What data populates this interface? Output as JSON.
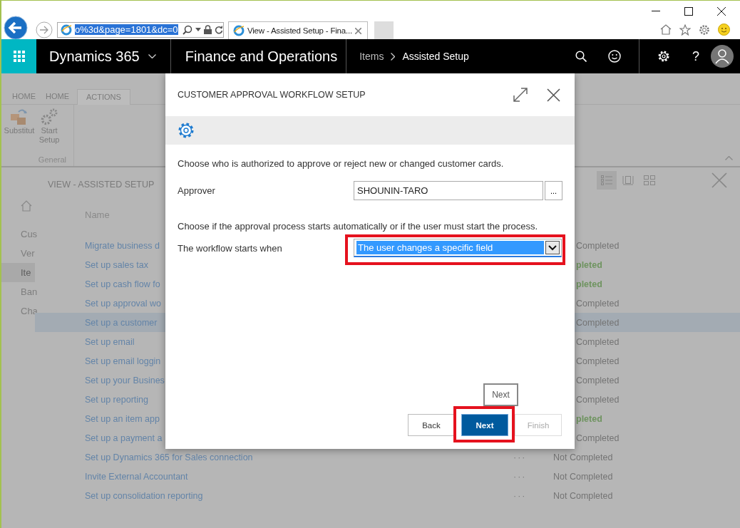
{
  "browser": {
    "address": "o%3d&page=1801&dc=0",
    "tab_title": "View - Assisted Setup - Fina..."
  },
  "app_bar": {
    "product": "Dynamics 365",
    "app": "Finance and Operations",
    "breadcrumb": [
      "Items",
      "Assisted Setup"
    ],
    "help": "?"
  },
  "ribbon": {
    "tabs": [
      {
        "label": "HOME",
        "selected": false
      },
      {
        "label": "HOME",
        "selected": false
      },
      {
        "label": "ACTIONS",
        "selected": true
      }
    ],
    "buttons": [
      {
        "label": "Substitut",
        "kind": "boxes"
      },
      {
        "label": "Start Setup",
        "kind": "gears"
      }
    ],
    "group": "General"
  },
  "page": {
    "title": "VIEW - ASSISTED SETUP",
    "views": [
      {
        "kind": "list",
        "selected": true
      },
      {
        "kind": "card",
        "selected": false
      },
      {
        "kind": "tiles",
        "selected": false
      }
    ],
    "nav": [
      {
        "label": "Cus",
        "selected": false
      },
      {
        "label": "Ver",
        "selected": false
      },
      {
        "label": "Ite",
        "selected": true
      },
      {
        "label": "Ban",
        "selected": false
      },
      {
        "label": "Cha",
        "selected": false
      }
    ],
    "column": "Name",
    "rows": [
      {
        "name": "Migrate business d",
        "status": "Completed",
        "completed": false,
        "selected": false
      },
      {
        "name": "Set up sales tax",
        "status": "pleted",
        "completed": true,
        "selected": false
      },
      {
        "name": "Set up cash flow fo",
        "status": "pleted",
        "completed": true,
        "selected": false
      },
      {
        "name": "Set up approval wo",
        "status": "Completed",
        "completed": false,
        "selected": false
      },
      {
        "name": "Set up a customer",
        "status": "Completed",
        "completed": false,
        "selected": true
      },
      {
        "name": "Set up email",
        "status": "Completed",
        "completed": false,
        "selected": false
      },
      {
        "name": "Set up email loggin",
        "status": "Completed",
        "completed": false,
        "selected": false
      },
      {
        "name": "Set up your Busines",
        "status": "Completed",
        "completed": false,
        "selected": false
      },
      {
        "name": "Set up reporting",
        "status": "Completed",
        "completed": false,
        "selected": false
      },
      {
        "name": "Set up an item app",
        "status": "pleted",
        "completed": true,
        "selected": false
      },
      {
        "name": "Set up a payment a",
        "status": "Completed",
        "completed": false,
        "selected": false
      },
      {
        "name": "Set up Dynamics 365 for Sales connection",
        "menu": "···",
        "status": "Not Completed",
        "completed": false,
        "selected": false
      },
      {
        "name": "Invite External Accountant",
        "menu": "···",
        "status": "Not Completed",
        "completed": false,
        "selected": false
      },
      {
        "name": "Set up consolidation reporting",
        "menu": "···",
        "status": "Not Completed",
        "completed": false,
        "selected": false
      }
    ]
  },
  "dialog": {
    "title": "CUSTOMER APPROVAL WORKFLOW SETUP",
    "intro": "Choose who is authorized to approve or reject new or changed customer cards.",
    "approver_label": "Approver",
    "approver_value": "SHOUNIN-TARO",
    "lookup": "...",
    "start_text": "Choose if the approval process starts automatically or if the user must start the process.",
    "start_label": "The workflow starts when",
    "start_value": "The user changes a specific field",
    "start_highlighted": true,
    "tooltip": "Next",
    "buttons": [
      {
        "label": "Back",
        "kind": "normal",
        "disabled": false,
        "highlighted": false
      },
      {
        "label": "Next",
        "kind": "primary",
        "disabled": false,
        "highlighted": true
      },
      {
        "label": "Finish",
        "kind": "normal",
        "disabled": true,
        "highlighted": false
      }
    ]
  }
}
